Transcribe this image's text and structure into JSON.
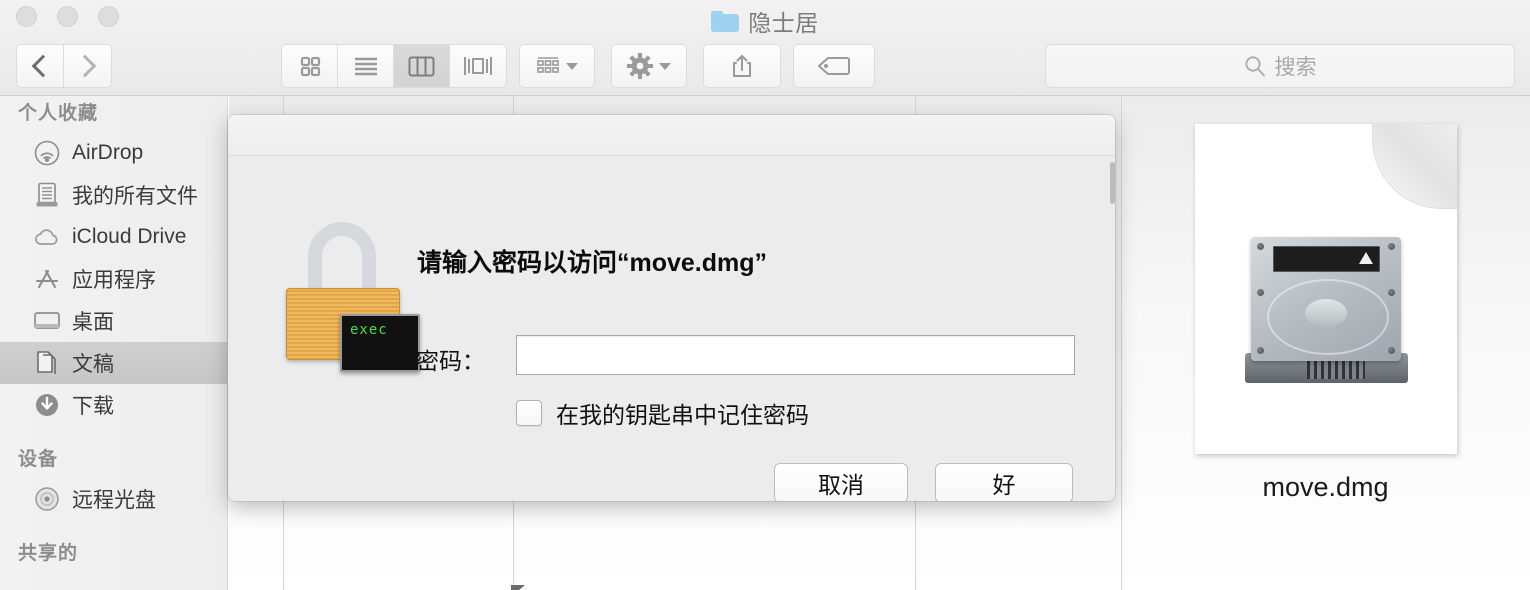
{
  "window": {
    "title": "隐士居",
    "folder_icon": "folder-icon",
    "traffic_lights": [
      "close-button",
      "minimize-button",
      "zoom-button"
    ]
  },
  "toolbar": {
    "back_icon": "chevron-left-icon",
    "forward_icon": "chevron-right-icon",
    "view_modes": [
      {
        "name": "icon-view",
        "icon": "grid-icon",
        "active": false
      },
      {
        "name": "list-view",
        "icon": "list-icon",
        "active": false
      },
      {
        "name": "column-view",
        "icon": "columns-icon",
        "active": true
      },
      {
        "name": "coverflow-view",
        "icon": "coverflow-icon",
        "active": false
      }
    ],
    "arrange_icon": "arrange-grid-icon",
    "action_icon": "gear-icon",
    "share_icon": "share-icon",
    "tag_icon": "tag-icon"
  },
  "search": {
    "placeholder": "搜索",
    "value": "",
    "icon": "search-icon"
  },
  "sidebar": {
    "sections": [
      {
        "header": "个人收藏",
        "items": [
          {
            "label": "AirDrop",
            "icon": "airdrop-icon",
            "selected": false
          },
          {
            "label": "我的所有文件",
            "icon": "all-my-files-icon",
            "selected": false
          },
          {
            "label": "iCloud Drive",
            "icon": "icloud-icon",
            "selected": false
          },
          {
            "label": "应用程序",
            "icon": "applications-icon",
            "selected": false
          },
          {
            "label": "桌面",
            "icon": "desktop-icon",
            "selected": false
          },
          {
            "label": "文稿",
            "icon": "documents-icon",
            "selected": true
          },
          {
            "label": "下载",
            "icon": "downloads-icon",
            "selected": false
          }
        ]
      },
      {
        "header": "设备",
        "items": [
          {
            "label": "远程光盘",
            "icon": "remote-disc-icon",
            "selected": false
          }
        ]
      },
      {
        "header": "共享的",
        "items": []
      }
    ]
  },
  "content": {
    "file": {
      "name": "move.dmg",
      "icon": "disk-image-icon"
    }
  },
  "dialog": {
    "lock_icon": "padlock-icon",
    "terminal_text": "exec",
    "title": "请输入密码以访问“move.dmg”",
    "password_label": "密码：",
    "password_value": "",
    "password_placeholder": "",
    "remember_label": "在我的钥匙串中记住密码",
    "remember_checked": false,
    "cancel_label": "取消",
    "ok_label": "好"
  },
  "colors": {
    "sheet_bg": "#ececec",
    "toolbar_bg": "#eeeeee",
    "sidebar_bg": "#f0f0f0",
    "selection": "#cacaca",
    "folder_blue": "#9fd1f0",
    "lock_gold": "#e8ad4c",
    "terminal_green": "#3ee23e"
  }
}
